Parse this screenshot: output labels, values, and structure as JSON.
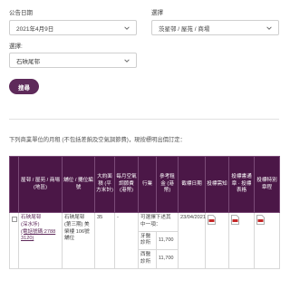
{
  "filters": {
    "date_label": "公告日期",
    "date_value": "2021年4月9日",
    "select_label1": "選擇",
    "select_value1": "茨星邨 / 屋苑 / 商場",
    "select_label2": "選擇:",
    "select_value2": "石硤尾邨",
    "search_button": "搜尋"
  },
  "note": "下列商業單位的月租 (不包括差餉及空氣調節費)，現按標明出價訂定：",
  "table": {
    "headers": [
      "",
      "屋邨 / 屋苑 / 商場 (地區)",
      "舖位 / 攤位編號",
      "大約面積 (平方米計)",
      "每月空氣調節費 (港幣)",
      "行業",
      "參考租金 (港幣)",
      "截標日期",
      "投標需知",
      "投標書通章 · 投標表格",
      "投標特別章程"
    ],
    "row": {
      "estate_name": "石硤尾邨",
      "estate_district": "(深水埗)",
      "estate_phone": "(電話號碼:2788 3120)",
      "shop_no": "石硤尾邨 (第三期) 美榮樓 106號舖位",
      "area": "35",
      "ac_fee": "-",
      "trades": [
        {
          "trade": "可選擇下述其中一項：",
          "rent": ""
        },
        {
          "trade": "牙醫診所",
          "rent": "11,700"
        },
        {
          "trade": "西醫診所",
          "rent": "11,700"
        }
      ],
      "closing_date": "23/04/2021"
    }
  }
}
